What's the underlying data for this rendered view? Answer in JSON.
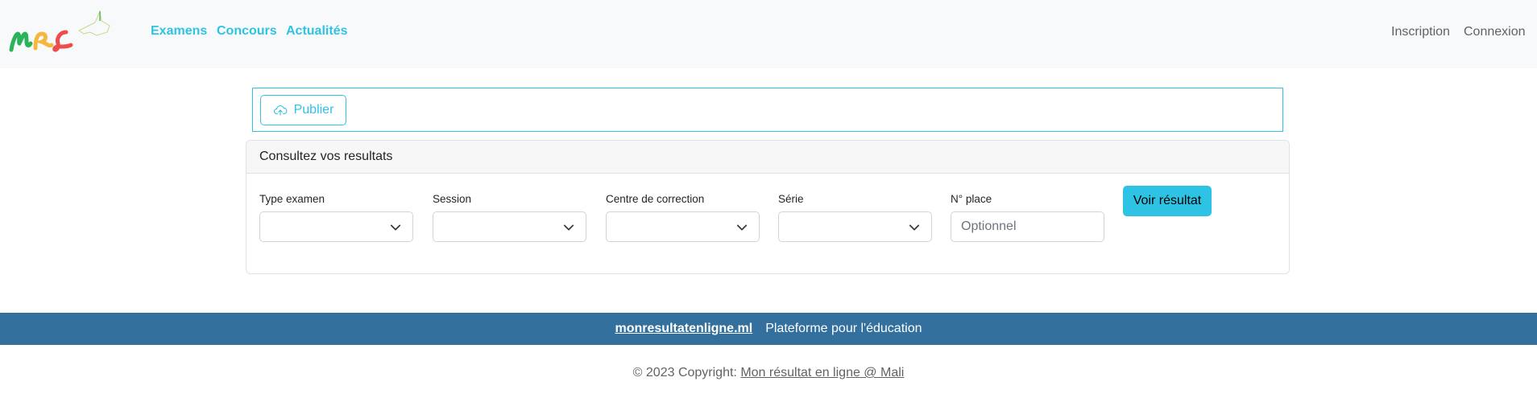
{
  "logo": {
    "text": "MRL"
  },
  "nav": {
    "links": [
      {
        "label": "Examens"
      },
      {
        "label": "Concours"
      },
      {
        "label": "Actualités"
      }
    ],
    "right": [
      {
        "label": "Inscription"
      },
      {
        "label": "Connexion"
      }
    ]
  },
  "publish": {
    "label": "Publier",
    "icon": "cloud-upload-icon"
  },
  "card": {
    "header": "Consultez vos resultats",
    "fields": [
      {
        "label": "Type examen",
        "value": ""
      },
      {
        "label": "Session",
        "value": ""
      },
      {
        "label": "Centre de correction",
        "value": ""
      },
      {
        "label": "Série",
        "value": ""
      }
    ],
    "place": {
      "label": "N° place",
      "placeholder": "Optionnel"
    },
    "submit_label": "Voir résultat"
  },
  "footer": {
    "site": "monresultatenligne.ml",
    "tagline": "Plateforme pour l'éducation",
    "copyright_prefix": "© 2023 Copyright:",
    "copyright_link": "Mon résultat en ligne @ Mali"
  },
  "colors": {
    "accent": "#2ec3e4",
    "footer": "#33709d",
    "navbar": "#f8f9fa"
  }
}
